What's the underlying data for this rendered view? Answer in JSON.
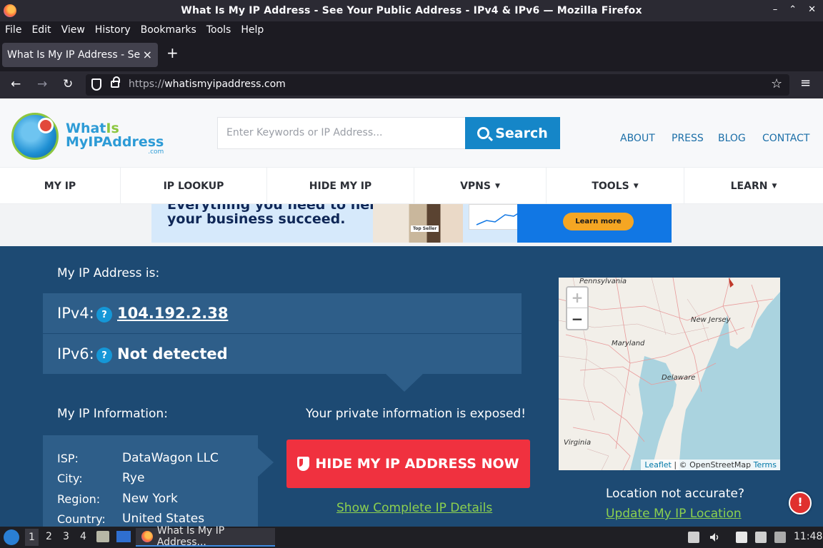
{
  "window": {
    "title": "What Is My IP Address - See Your Public Address - IPv4 & IPv6 — Mozilla Firefox",
    "controls": [
      "–",
      "⌃",
      "✕"
    ]
  },
  "menu": [
    "File",
    "Edit",
    "View",
    "History",
    "Bookmarks",
    "Tools",
    "Help"
  ],
  "tab": {
    "label": "What Is My IP Address - See Your Public Address",
    "close": "×",
    "new": "+"
  },
  "nav": {
    "back": "←",
    "forward": "→",
    "reload": "↻",
    "url_proto": "https://",
    "url_host": "whatismyipaddress.com",
    "star": "☆",
    "menu": "≡"
  },
  "site": {
    "logo": {
      "line1a": "What",
      "line1b": "Is",
      "line2": "MyIPAddress",
      "line3": ".com"
    },
    "search": {
      "placeholder": "Enter Keywords or IP Address...",
      "button": "Search"
    },
    "top_links": [
      "ABOUT",
      "PRESS",
      "BLOG",
      "CONTACT"
    ],
    "main_nav": [
      {
        "label": "MY IP",
        "caret": ""
      },
      {
        "label": "IP LOOKUP",
        "caret": ""
      },
      {
        "label": "HIDE MY IP",
        "caret": ""
      },
      {
        "label": "VPNS",
        "caret": "▼"
      },
      {
        "label": "TOOLS",
        "caret": "▼"
      },
      {
        "label": "LEARN",
        "caret": "▼"
      }
    ],
    "ad": {
      "top_text": "Everything you need to help",
      "line": "your business succeed.",
      "badge": "Top Seller",
      "cta": "Learn more"
    }
  },
  "ip": {
    "heading": "My IP Address is:",
    "ipv4_label": "IPv4:",
    "ipv4_value": "104.192.2.38",
    "ipv6_label": "IPv6:",
    "ipv6_value": "Not detected",
    "help": "?"
  },
  "info": {
    "heading": "My IP Information:",
    "rows": [
      {
        "label": "ISP:",
        "value": "DataWagon LLC"
      },
      {
        "label": "City:",
        "value": "Rye"
      },
      {
        "label": "Region:",
        "value": "New York"
      },
      {
        "label": "Country:",
        "value": "United States"
      }
    ]
  },
  "exposed": {
    "text": "Your private information is exposed!",
    "button": "HIDE MY IP ADDRESS NOW",
    "details_link": "Show Complete IP Details"
  },
  "map": {
    "zoom_in": "+",
    "zoom_out": "−",
    "labels": [
      "Pennsylvania",
      "New Jersey",
      "Maryland",
      "Delaware",
      "Virginia"
    ],
    "attribution_leaflet": "Leaflet",
    "attribution_sep": " | © OpenStreetMap ",
    "attribution_terms": "Terms"
  },
  "location": {
    "text": "Location not accurate?",
    "link": "Update My IP Location"
  },
  "taskbar": {
    "workspaces": [
      "1",
      "2",
      "3",
      "4"
    ],
    "task_label": "What Is My IP Address...",
    "clock": "11:48"
  }
}
